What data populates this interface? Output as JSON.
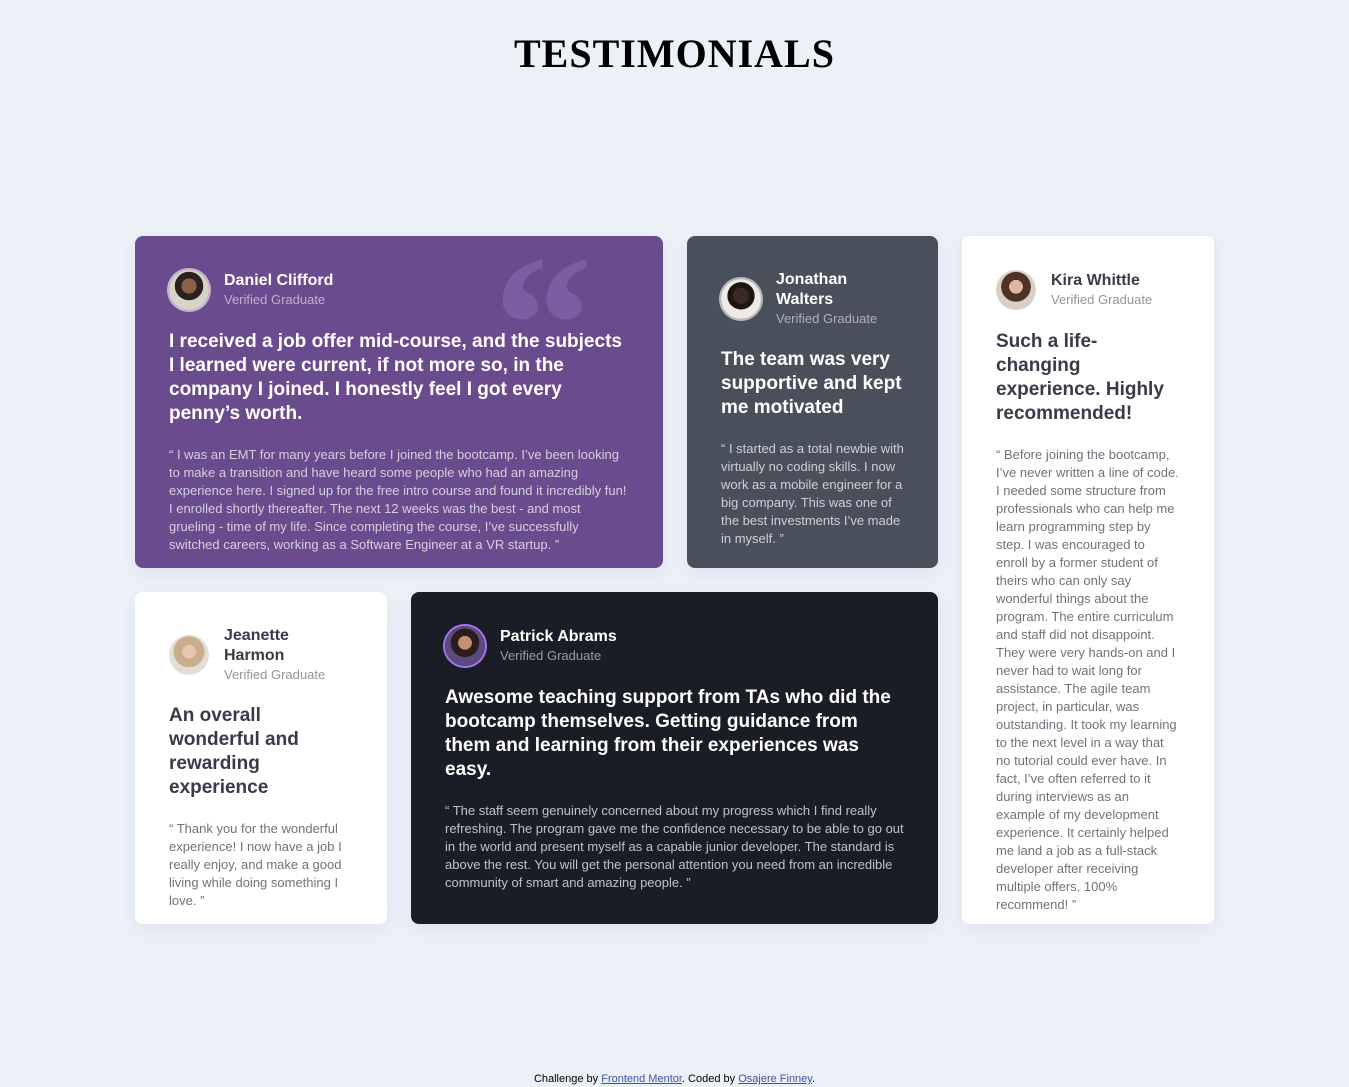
{
  "page": {
    "title": "TESTIMONIALS"
  },
  "testimonials": [
    {
      "name": "Daniel Clifford",
      "role": "Verified Graduate",
      "headline": "I received a job offer mid-course, and the subjects I learned were current, if not more so, in the company I joined. I honestly feel I got every penny’s worth.",
      "body": "“ I was an EMT for many years before I joined the bootcamp. I’ve been looking to make a transition and have heard some people who had an amazing experience here. I signed up for the free intro course and found it incredibly fun! I enrolled shortly thereafter. The next 12 weeks was the best - and most grueling - time of my life. Since completing the course, I’ve successfully switched careers, working as a Software Engineer at a VR startup. ”",
      "quote_glyph": "“"
    },
    {
      "name": "Jonathan Walters",
      "role": "Verified Graduate",
      "headline": "The team was very supportive and kept me motivated",
      "body": "“ I started as a total newbie with virtually no coding skills. I now work as a mobile engineer for a big company. This was one of the best investments I’ve made in myself. ”"
    },
    {
      "name": "Kira Whittle",
      "role": "Verified Graduate",
      "headline": "Such a life-changing experience. Highly recommended!",
      "body": "“ Before joining the bootcamp, I’ve never written a line of code. I needed some structure from professionals who can help me learn programming step by step. I was encouraged to enroll by a former student of theirs who can only say wonderful things about the program. The entire curriculum and staff did not disappoint. They were very hands-on and I never had to wait long for assistance. The agile team project, in particular, was outstanding. It took my learning to the next level in a way that no tutorial could ever have. In fact, I’ve often referred to it during interviews as an example of my development experience. It certainly helped me land a job as a full-stack developer after receiving multiple offers. 100% recommend! ”"
    },
    {
      "name": "Jeanette Harmon",
      "role": "Verified Graduate",
      "headline": "An overall wonderful and rewarding experience",
      "body": "“ Thank you for the wonderful experience! I now have a job I really enjoy, and make a good living while doing something I love. ”"
    },
    {
      "name": "Patrick Abrams",
      "role": "Verified Graduate",
      "headline": "Awesome teaching support from TAs who did the bootcamp themselves. Getting guidance from them and learning from their experiences was easy.",
      "body": "“ The staff seem genuinely concerned about my progress which I find really refreshing. The program gave me the confidence necessary to be able to go out in the world and present myself as a capable junior developer. The standard is above the rest. You will get the personal attention you need from an incredible community of smart and amazing people. ”"
    }
  ],
  "footer": {
    "prefix": "Challenge by",
    "link1": "Frontend Mentor",
    "middle": ". Coded by",
    "link2": "Osajere Finney",
    "suffix": "."
  },
  "colors": {
    "background": "#ecf1f8",
    "purple": "#6a4b8e",
    "gray": "#4a4f5c",
    "dark": "#1a1d25",
    "white": "#ffffff"
  }
}
